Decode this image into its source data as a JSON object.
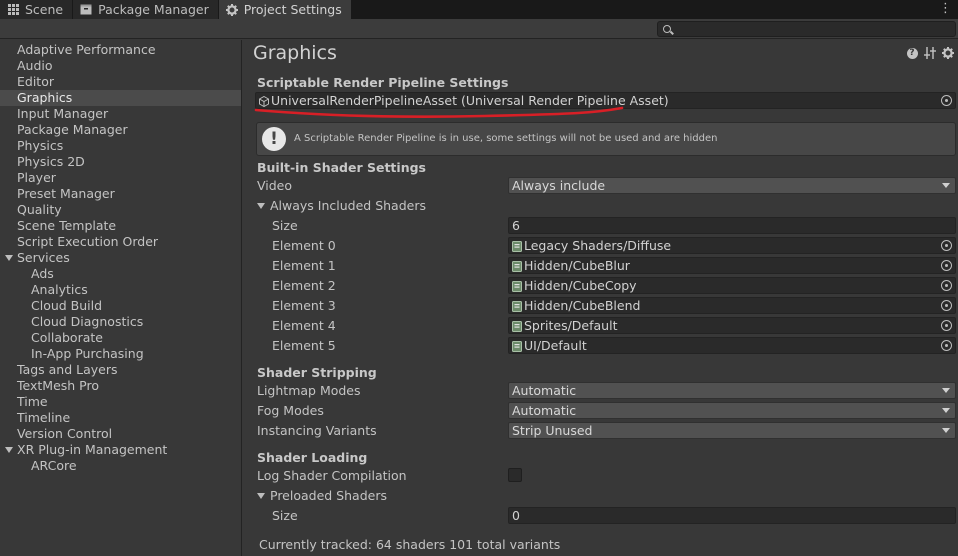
{
  "tabs": [
    {
      "label": "Scene",
      "icon": "grid-icon"
    },
    {
      "label": "Package Manager",
      "icon": "package-icon"
    },
    {
      "label": "Project Settings",
      "icon": "gear-icon",
      "active": true
    }
  ],
  "search": {
    "placeholder": "",
    "value": ""
  },
  "sidebar": {
    "items": [
      {
        "label": "Adaptive Performance"
      },
      {
        "label": "Audio"
      },
      {
        "label": "Editor"
      },
      {
        "label": "Graphics",
        "selected": true
      },
      {
        "label": "Input Manager"
      },
      {
        "label": "Package Manager"
      },
      {
        "label": "Physics"
      },
      {
        "label": "Physics 2D"
      },
      {
        "label": "Player"
      },
      {
        "label": "Preset Manager"
      },
      {
        "label": "Quality"
      },
      {
        "label": "Scene Template"
      },
      {
        "label": "Script Execution Order"
      },
      {
        "label": "Services",
        "expanded": true
      },
      {
        "label": "Ads",
        "child": true
      },
      {
        "label": "Analytics",
        "child": true
      },
      {
        "label": "Cloud Build",
        "child": true
      },
      {
        "label": "Cloud Diagnostics",
        "child": true
      },
      {
        "label": "Collaborate",
        "child": true
      },
      {
        "label": "In-App Purchasing",
        "child": true
      },
      {
        "label": "Tags and Layers"
      },
      {
        "label": "TextMesh Pro"
      },
      {
        "label": "Time"
      },
      {
        "label": "Timeline"
      },
      {
        "label": "Version Control"
      },
      {
        "label": "XR Plug-in Management",
        "expanded": true
      },
      {
        "label": "ARCore",
        "child": true
      }
    ]
  },
  "main": {
    "title": "Graphics",
    "srp": {
      "section": "Scriptable Render Pipeline Settings",
      "asset": "UniversalRenderPipelineAsset (Universal Render Pipeline Asset)",
      "info": "A Scriptable Render Pipeline is in use, some settings will not be used and are hidden"
    },
    "builtin": {
      "section": "Built-in Shader Settings",
      "video_label": "Video",
      "video_value": "Always include",
      "always_label": "Always Included Shaders",
      "size_label": "Size",
      "size_value": "6",
      "elements": [
        {
          "label": "Element 0",
          "value": "Legacy Shaders/Diffuse"
        },
        {
          "label": "Element 1",
          "value": "Hidden/CubeBlur"
        },
        {
          "label": "Element 2",
          "value": "Hidden/CubeCopy"
        },
        {
          "label": "Element 3",
          "value": "Hidden/CubeBlend"
        },
        {
          "label": "Element 4",
          "value": "Sprites/Default"
        },
        {
          "label": "Element 5",
          "value": "UI/Default"
        }
      ]
    },
    "stripping": {
      "section": "Shader Stripping",
      "rows": [
        {
          "label": "Lightmap Modes",
          "value": "Automatic"
        },
        {
          "label": "Fog Modes",
          "value": "Automatic"
        },
        {
          "label": "Instancing Variants",
          "value": "Strip Unused"
        }
      ]
    },
    "loading": {
      "section": "Shader Loading",
      "log_label": "Log Shader Compilation",
      "preloaded_label": "Preloaded Shaders",
      "size_label": "Size",
      "size_value": "0"
    },
    "footer": "Currently tracked: 64 shaders 101 total variants"
  },
  "colors": {
    "annotation": "#d81f26",
    "background": "#383838"
  }
}
